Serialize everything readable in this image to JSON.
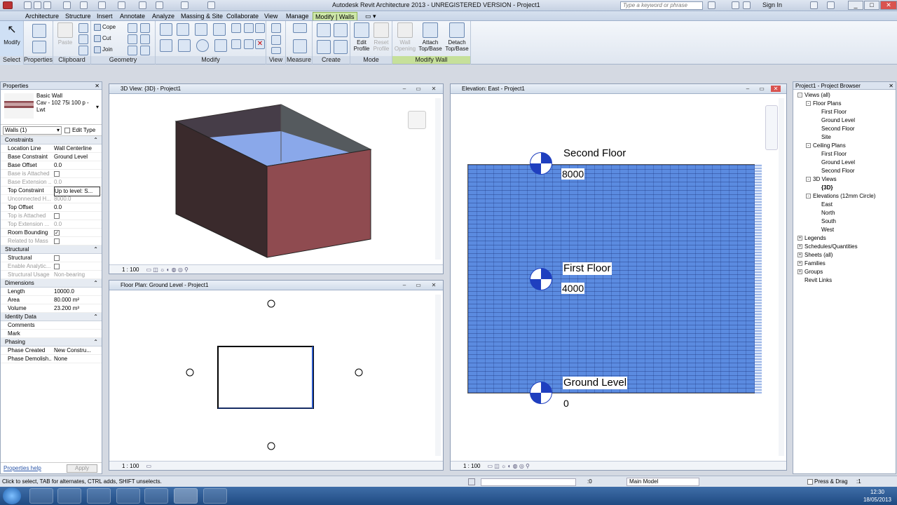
{
  "window": {
    "title": "Autodesk Revit Architecture 2013 - UNREGISTERED VERSION -   Project1",
    "search_placeholder": "Type a keyword or phrase",
    "sign_in": "Sign In"
  },
  "tabs": [
    "Architecture",
    "Structure",
    "Insert",
    "Annotate",
    "Analyze",
    "Massing & Site",
    "Collaborate",
    "View",
    "Manage",
    "Modify | Walls"
  ],
  "ribbon": {
    "modify_label": "Modify",
    "panels": {
      "select": "Select",
      "properties": "Properties",
      "clipboard": "Clipboard",
      "geometry": "Geometry",
      "modify": "Modify",
      "view": "View",
      "measure": "Measure",
      "create": "Create",
      "mode": "Mode",
      "modify_wall": "Modify Wall"
    },
    "clipboard": {
      "paste": "Paste"
    },
    "geometry": {
      "cope": "Cope",
      "cut": "Cut",
      "join": "Join"
    },
    "mode": {
      "edit_profile": "Edit Profile",
      "reset_profile": "Reset Profile"
    },
    "modify_wall": {
      "wall_opening": "Wall Opening",
      "attach": "Attach Top/Base",
      "detach": "Detach Top/Base"
    }
  },
  "properties": {
    "title": "Properties",
    "type_name": "Basic Wall",
    "type_sub": "Cav - 102 75i 100 p - Lwt",
    "selector": "Walls (1)",
    "edit_type": "Edit Type",
    "sections": {
      "constraints": "Constraints",
      "structural": "Structural",
      "dimensions": "Dimensions",
      "identity": "Identity Data",
      "phasing": "Phasing"
    },
    "constraints": [
      {
        "k": "Location Line",
        "v": "Wall Centerline"
      },
      {
        "k": "Base Constraint",
        "v": "Ground Level"
      },
      {
        "k": "Base Offset",
        "v": "0.0"
      },
      {
        "k": "Base is Attached",
        "v": ""
      },
      {
        "k": "Base Extension ...",
        "v": "0.0"
      },
      {
        "k": "Top Constraint",
        "v": "Up to level: S..."
      },
      {
        "k": "Unconnected H...",
        "v": "8000.0"
      },
      {
        "k": "Top Offset",
        "v": "0.0"
      },
      {
        "k": "Top is Attached",
        "v": ""
      },
      {
        "k": "Top Extension ...",
        "v": "0.0"
      },
      {
        "k": "Room Bounding",
        "v": "✓"
      },
      {
        "k": "Related to Mass",
        "v": ""
      }
    ],
    "structural": [
      {
        "k": "Structural",
        "v": ""
      },
      {
        "k": "Enable Analytic...",
        "v": ""
      },
      {
        "k": "Structural Usage",
        "v": "Non-bearing"
      }
    ],
    "dimensions": [
      {
        "k": "Length",
        "v": "10000.0"
      },
      {
        "k": "Area",
        "v": "80.000 m²"
      },
      {
        "k": "Volume",
        "v": "23.200 m³"
      }
    ],
    "identity": [
      {
        "k": "Comments",
        "v": ""
      },
      {
        "k": "Mark",
        "v": ""
      }
    ],
    "phasing": [
      {
        "k": "Phase Created",
        "v": "New Constru..."
      },
      {
        "k": "Phase Demolish...",
        "v": "None"
      }
    ],
    "help": "Properties help",
    "apply": "Apply"
  },
  "views": {
    "v3d": {
      "title": "3D View: {3D} - Project1",
      "scale": "1 : 100"
    },
    "plan": {
      "title": "Floor Plan: Ground Level - Project1",
      "scale": "1 : 100"
    },
    "elev": {
      "title": "Elevation: East - Project1",
      "scale": "1 : 100",
      "levels": [
        {
          "name": "Second Floor",
          "value": "8000"
        },
        {
          "name": "First Floor",
          "value": "4000"
        },
        {
          "name": "Ground Level",
          "value": "0"
        }
      ]
    }
  },
  "browser": {
    "title": "Project1 - Project Browser",
    "items": [
      {
        "label": "Views (all)",
        "indent": 0,
        "toggle": "-"
      },
      {
        "label": "Floor Plans",
        "indent": 1,
        "toggle": "-"
      },
      {
        "label": "First Floor",
        "indent": 2,
        "toggle": ""
      },
      {
        "label": "Ground Level",
        "indent": 2,
        "toggle": ""
      },
      {
        "label": "Second Floor",
        "indent": 2,
        "toggle": ""
      },
      {
        "label": "Site",
        "indent": 2,
        "toggle": ""
      },
      {
        "label": "Ceiling Plans",
        "indent": 1,
        "toggle": "-"
      },
      {
        "label": "First Floor",
        "indent": 2,
        "toggle": ""
      },
      {
        "label": "Ground Level",
        "indent": 2,
        "toggle": ""
      },
      {
        "label": "Second Floor",
        "indent": 2,
        "toggle": ""
      },
      {
        "label": "3D Views",
        "indent": 1,
        "toggle": "-"
      },
      {
        "label": "{3D}",
        "indent": 2,
        "toggle": ""
      },
      {
        "label": "Elevations (12mm Circle)",
        "indent": 1,
        "toggle": "-"
      },
      {
        "label": "East",
        "indent": 2,
        "toggle": ""
      },
      {
        "label": "North",
        "indent": 2,
        "toggle": ""
      },
      {
        "label": "South",
        "indent": 2,
        "toggle": ""
      },
      {
        "label": "West",
        "indent": 2,
        "toggle": ""
      },
      {
        "label": "Legends",
        "indent": 0,
        "toggle": "+"
      },
      {
        "label": "Schedules/Quantities",
        "indent": 0,
        "toggle": "+"
      },
      {
        "label": "Sheets (all)",
        "indent": 0,
        "toggle": "+"
      },
      {
        "label": "Families",
        "indent": 0,
        "toggle": "+"
      },
      {
        "label": "Groups",
        "indent": 0,
        "toggle": "+"
      },
      {
        "label": "Revit Links",
        "indent": 0,
        "toggle": ""
      }
    ]
  },
  "status": {
    "hint": "Click to select, TAB for alternates, CTRL adds, SHIFT unselects.",
    "filter": ":0",
    "model": "Main Model",
    "press_drag": "Press & Drag",
    "filter2": ":1"
  },
  "taskbar": {
    "time": "12:30",
    "date": "18/05/2013"
  },
  "colors": {
    "wall_blue": "#5b8be0",
    "box_top": "#8aa8ea",
    "box_side": "#8f4b50",
    "box_dark": "#3a2a2c",
    "accent": "#cde7a8"
  }
}
